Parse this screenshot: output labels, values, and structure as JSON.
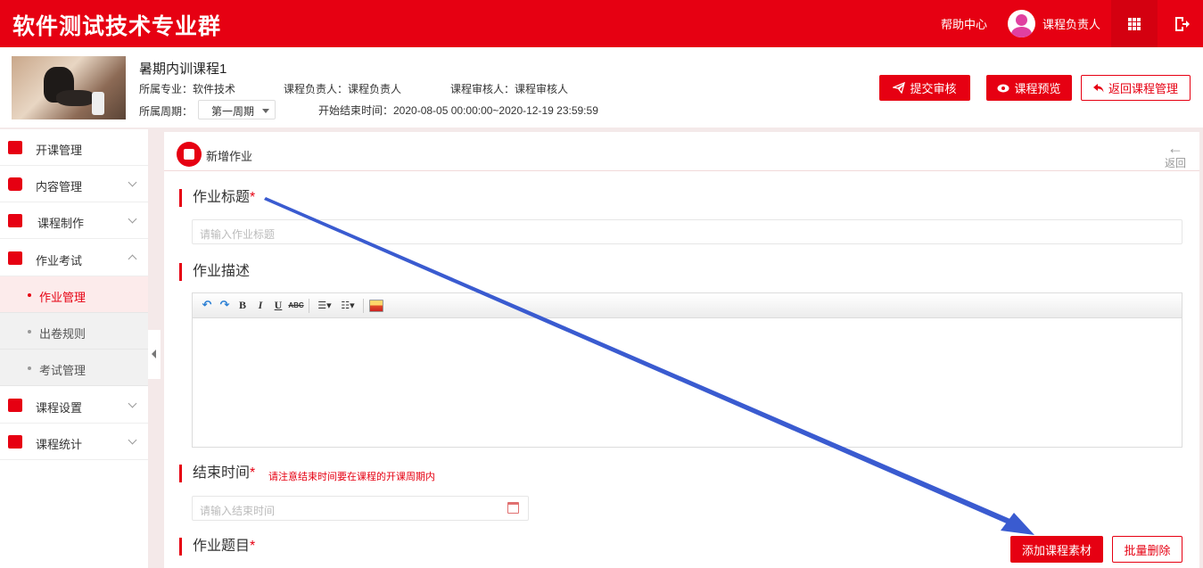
{
  "app": {
    "brand": "软件测试技术专业群",
    "help": "帮助中心",
    "user_name": "课程负责人"
  },
  "course": {
    "title": "暑期内训课程1",
    "major": "所属专业：软件技术",
    "owner": "课程负责人：课程负责人",
    "reviewer": "课程审核人：课程审核人",
    "period_label": "所属周期：",
    "period_value": "第一周期",
    "time_range": "开始结束时间：2020-08-05 00:00:00~2020-12-19 23:59:59",
    "buttons": {
      "submit": "提交审核",
      "preview": "课程预览",
      "back_manage": "返回课程管理"
    }
  },
  "sidebar": {
    "items": [
      {
        "label": "开课管理"
      },
      {
        "label": "内容管理"
      },
      {
        "label": "课程制作"
      },
      {
        "label": "作业考试"
      },
      {
        "label": "课程设置"
      },
      {
        "label": "课程统计"
      }
    ],
    "sub_items": [
      {
        "label": "作业管理"
      },
      {
        "label": "出卷规则"
      },
      {
        "label": "考试管理"
      }
    ]
  },
  "panel": {
    "title": "新增作业",
    "back": "返回",
    "title_field": {
      "label": "作业标题",
      "required": "*",
      "placeholder": "请输入作业标题"
    },
    "desc_field": {
      "label": "作业描述"
    },
    "end_time": {
      "label": "结束时间",
      "required": "*",
      "hint": "请注意结束时间要在课程的开课周期内",
      "placeholder": "请输入结束时间"
    },
    "questions": {
      "label": "作业题目",
      "required": "*"
    },
    "buttons": {
      "add_material": "添加课程素材",
      "batch_delete": "批量删除"
    }
  },
  "colors": {
    "brand": "#e60012",
    "annotation_arrow": "#3a5bd0"
  }
}
